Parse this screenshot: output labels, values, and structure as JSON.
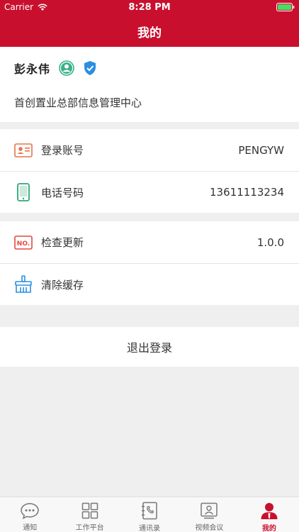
{
  "status_bar": {
    "carrier": "Carrier",
    "time": "8:28 PM"
  },
  "nav": {
    "title": "我的"
  },
  "profile": {
    "name": "彭永伟",
    "org": "首创置业总部信息管理中心"
  },
  "settings": [
    {
      "label": "登录账号",
      "value": "PENGYW",
      "icon": "id-card-icon"
    },
    {
      "label": "电话号码",
      "value": "13611113234",
      "icon": "phone-icon"
    }
  ],
  "system": [
    {
      "label": "检查更新",
      "value": "1.0.0",
      "icon": "version-no-icon"
    },
    {
      "label": "清除缓存",
      "value": "",
      "icon": "broom-icon"
    }
  ],
  "logout_label": "退出登录",
  "tabs": [
    {
      "label": "通知",
      "icon": "chat-bubble-icon"
    },
    {
      "label": "工作平台",
      "icon": "grid-icon"
    },
    {
      "label": "通讯录",
      "icon": "contacts-book-icon"
    },
    {
      "label": "视频会议",
      "icon": "video-meeting-icon"
    },
    {
      "label": "我的",
      "icon": "user-icon",
      "active": true
    }
  ],
  "colors": {
    "brand": "#c8102e",
    "background": "#efefef"
  }
}
